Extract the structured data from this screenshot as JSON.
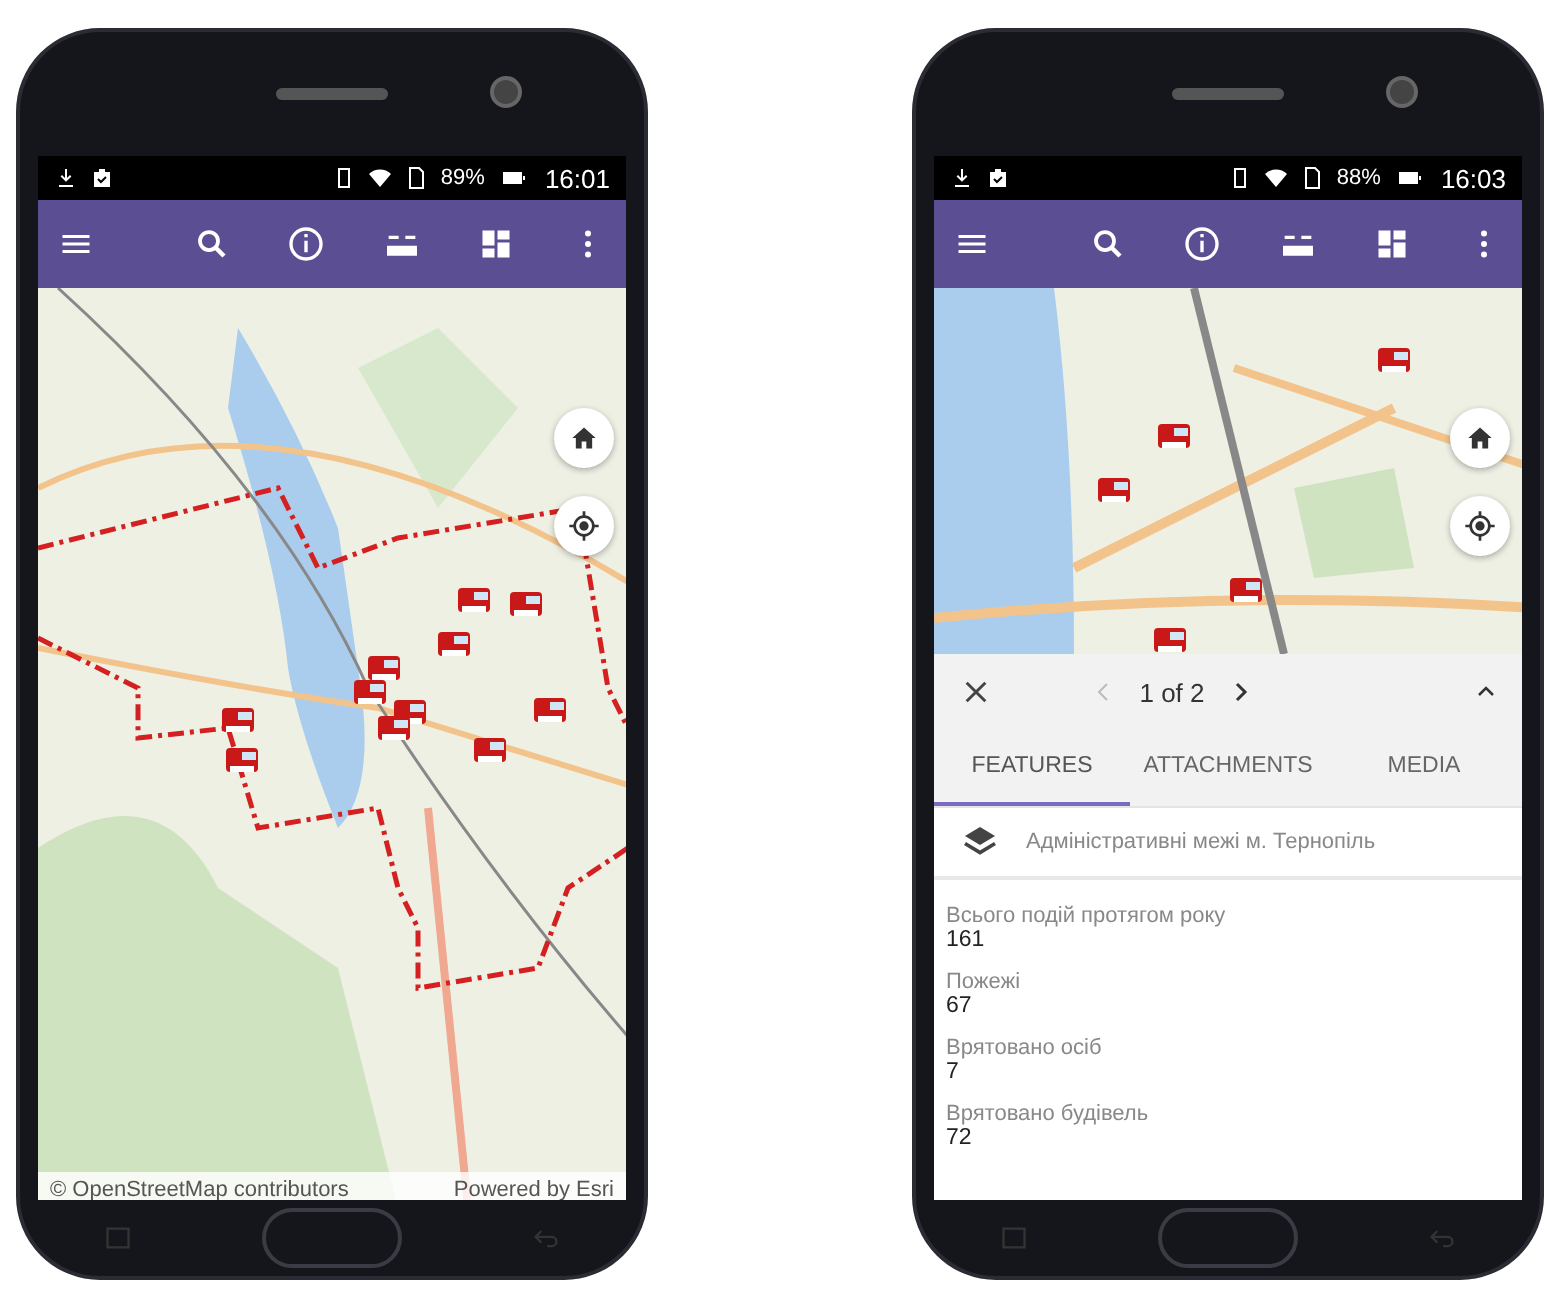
{
  "phones": [
    {
      "kind": "map",
      "status_bar": {
        "battery": "89%",
        "time": "16:01"
      },
      "map": {
        "attribution": "© OpenStreetMap contributors",
        "powered_by": "Powered by Esri"
      }
    },
    {
      "kind": "popup",
      "status_bar": {
        "battery": "88%",
        "time": "16:03"
      },
      "popup": {
        "pager": "1 of 2",
        "tabs": [
          {
            "label": "FEATURES",
            "selected": true
          },
          {
            "label": "ATTACHMENTS",
            "selected": false
          },
          {
            "label": "MEDIA",
            "selected": false
          }
        ],
        "layer": "Адміністративні межі м. Тернопіль",
        "fields": [
          {
            "label": "Всього подій протягом року",
            "value": "161"
          },
          {
            "label": "Пожежі",
            "value": "67"
          },
          {
            "label": "Врятовано осіб",
            "value": "7"
          },
          {
            "label": "Врятовано будівель",
            "value": "72"
          }
        ]
      }
    }
  ]
}
